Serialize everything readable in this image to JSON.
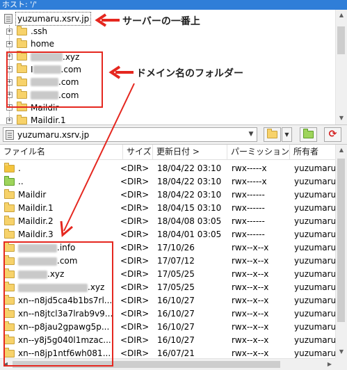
{
  "header": {
    "remote_path": "ホスト: '/'"
  },
  "tree": {
    "root": {
      "label": "yuzumaru.xsrv.jp",
      "icon": "server-icon"
    },
    "items": [
      {
        "label": ".ssh",
        "blurred_prefix": false
      },
      {
        "label": "home",
        "blurred_prefix": false
      },
      {
        "label": ".xyz",
        "blurred_prefix": true,
        "visible_lead": ""
      },
      {
        "label": ".com",
        "blurred_prefix": true,
        "visible_lead": "I"
      },
      {
        "label": ".com",
        "blurred_prefix": true,
        "visible_lead": ""
      },
      {
        "label": ".com",
        "blurred_prefix": true,
        "visible_lead": ""
      },
      {
        "label": "Maildir",
        "blurred_prefix": false
      },
      {
        "label": "Maildir.1",
        "blurred_prefix": false
      }
    ]
  },
  "toolbar": {
    "path_value": "yuzumaru.xsrv.jp",
    "dropdown_icon": "chevron-down-icon"
  },
  "columns": {
    "name": "ファイル名",
    "size": "サイズ",
    "modified": "更新日付 >",
    "permission": "パーミッション",
    "owner": "所有者"
  },
  "files": [
    {
      "name": ".",
      "size": "<DIR>",
      "modified": "18/04/22 03:10",
      "perm": "rwx-----x",
      "owner": "yuzumaru",
      "icon": "current-folder-icon"
    },
    {
      "name": "..",
      "size": "<DIR>",
      "modified": "18/04/22 03:10",
      "perm": "rwx-----x",
      "owner": "yuzumaru",
      "icon": "parent-folder-icon"
    },
    {
      "name": "Maildir",
      "size": "<DIR>",
      "modified": "18/04/22 03:10",
      "perm": "rwx------",
      "owner": "yuzumaru",
      "icon": "folder-icon"
    },
    {
      "name": "Maildir.1",
      "size": "<DIR>",
      "modified": "18/04/15 03:10",
      "perm": "rwx------",
      "owner": "yuzumaru",
      "icon": "folder-icon"
    },
    {
      "name": "Maildir.2",
      "size": "<DIR>",
      "modified": "18/04/08 03:05",
      "perm": "rwx------",
      "owner": "yuzumaru",
      "icon": "folder-icon"
    },
    {
      "name": "Maildir.3",
      "size": "<DIR>",
      "modified": "18/04/01 03:05",
      "perm": "rwx------",
      "owner": "yuzumaru",
      "icon": "folder-icon"
    },
    {
      "name": ".info",
      "size": "<DIR>",
      "modified": "17/10/26",
      "perm": "rwx--x--x",
      "owner": "yuzumaru",
      "icon": "folder-icon",
      "blurred": true
    },
    {
      "name": ".com",
      "size": "<DIR>",
      "modified": "17/07/12",
      "perm": "rwx--x--x",
      "owner": "yuzumaru",
      "icon": "folder-icon",
      "blurred": true
    },
    {
      "name": ".xyz",
      "size": "<DIR>",
      "modified": "17/05/25",
      "perm": "rwx--x--x",
      "owner": "yuzumaru",
      "icon": "folder-icon",
      "blurred": true
    },
    {
      "name": ".xyz",
      "size": "<DIR>",
      "modified": "17/05/25",
      "perm": "rwx--x--x",
      "owner": "yuzumaru",
      "icon": "folder-icon",
      "blurred": true
    },
    {
      "name": "xn--n8jd5ca4b1bs7rl...",
      "size": "<DIR>",
      "modified": "16/10/27",
      "perm": "rwx--x--x",
      "owner": "yuzumaru",
      "icon": "folder-icon"
    },
    {
      "name": "xn--n8jtcl3a7lrab9v9...",
      "size": "<DIR>",
      "modified": "16/10/27",
      "perm": "rwx--x--x",
      "owner": "yuzumaru",
      "icon": "folder-icon"
    },
    {
      "name": "xn--p8jau2gpawg5p...",
      "size": "<DIR>",
      "modified": "16/10/27",
      "perm": "rwx--x--x",
      "owner": "yuzumaru",
      "icon": "folder-icon"
    },
    {
      "name": "xn--y8j5g040l1mzac...",
      "size": "<DIR>",
      "modified": "16/10/27",
      "perm": "rwx--x--x",
      "owner": "yuzumaru",
      "icon": "folder-icon"
    },
    {
      "name": "xn--n8jp1ntf6wh081...",
      "size": "<DIR>",
      "modified": "16/07/21",
      "perm": "rwx--x--x",
      "owner": "yuzumaru",
      "icon": "folder-icon"
    }
  ],
  "annotations": {
    "server_top": "サーバーの一番上",
    "domain_folders": "ドメイン名のフォルダー",
    "accent_color": "#e5271f"
  }
}
